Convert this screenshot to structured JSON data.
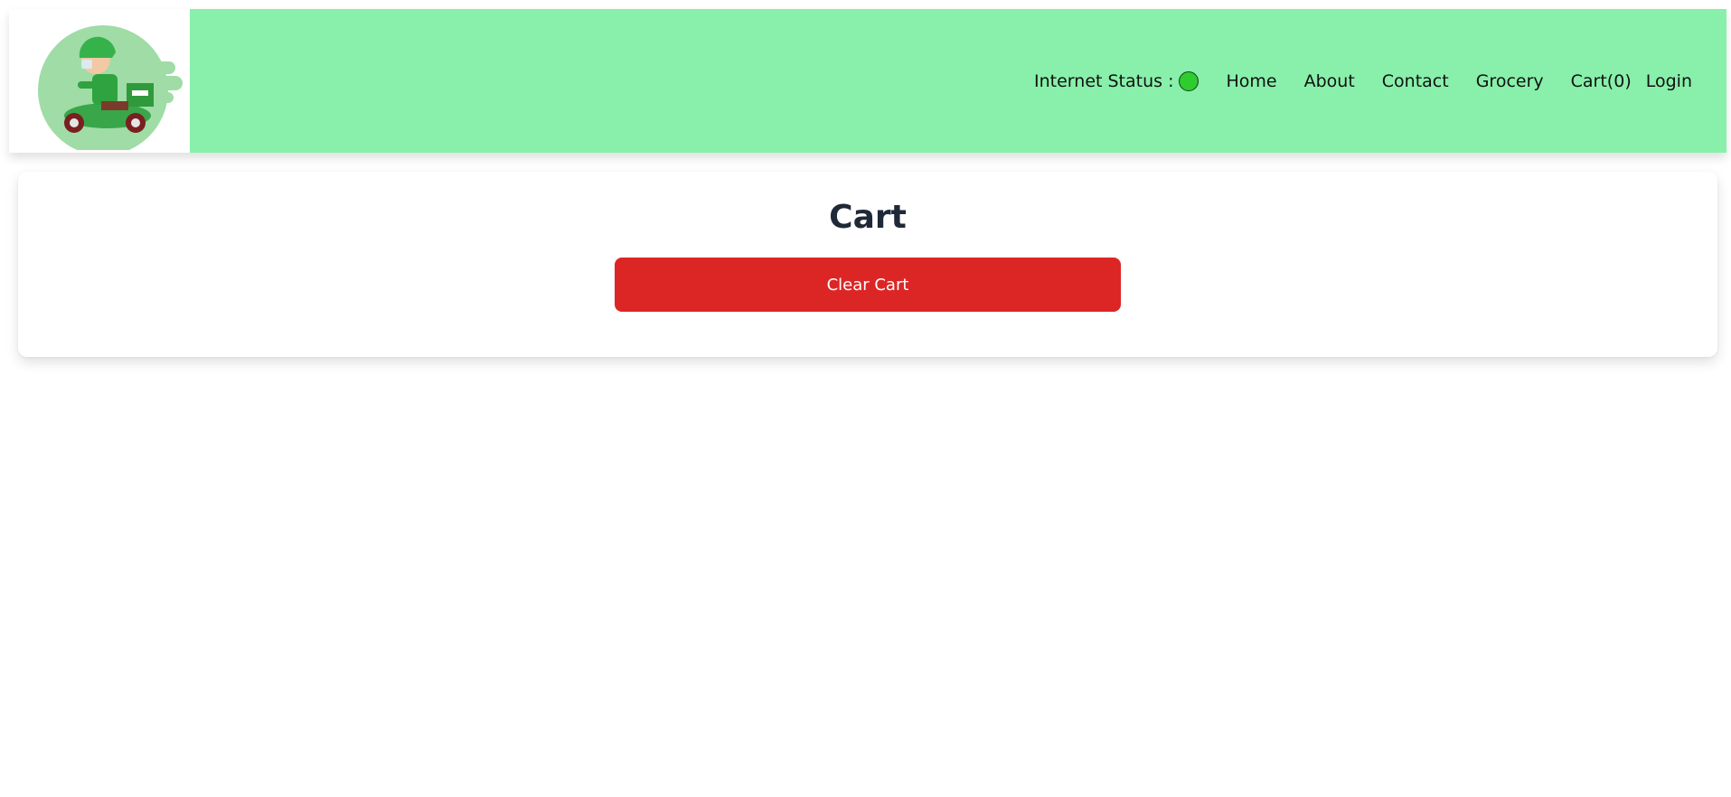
{
  "header": {
    "logo_alt": "delivery scooter logo",
    "status_label": "Internet Status :",
    "status_color": "#2ecc2e",
    "nav": {
      "home": "Home",
      "about": "About",
      "contact": "Contact",
      "grocery": "Grocery",
      "cart": "Cart(0)",
      "login": "Login"
    },
    "background_color": "#88f0aa"
  },
  "main": {
    "title": "Cart",
    "clear_button_label": "Clear Cart",
    "button_color": "#dc2626"
  }
}
